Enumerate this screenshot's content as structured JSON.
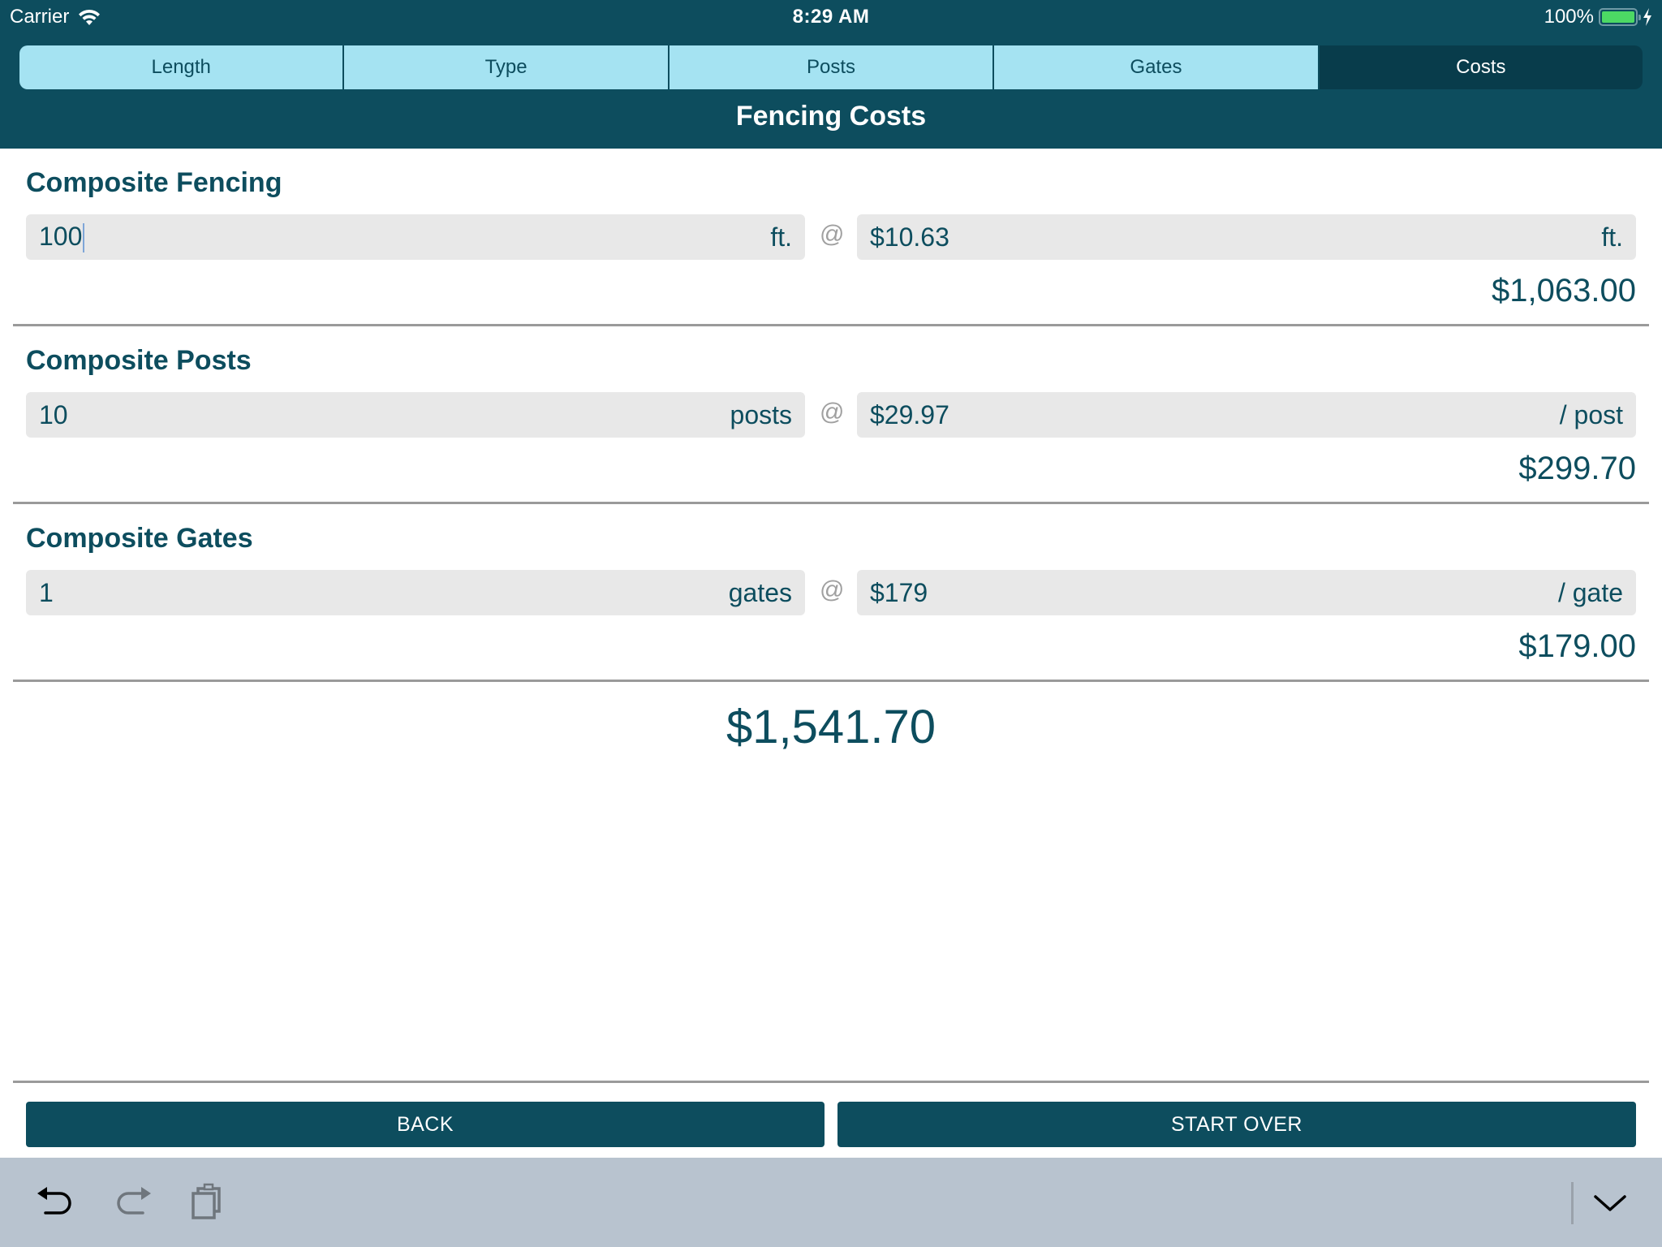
{
  "status_bar": {
    "carrier": "Carrier",
    "time": "8:29 AM",
    "battery_percent": "100%",
    "battery_level": 1.0,
    "charging": true
  },
  "tabs": [
    {
      "label": "Length",
      "active": false
    },
    {
      "label": "Type",
      "active": false
    },
    {
      "label": "Posts",
      "active": false
    },
    {
      "label": "Gates",
      "active": false
    },
    {
      "label": "Costs",
      "active": true
    }
  ],
  "header": {
    "title": "Fencing Costs"
  },
  "sections": [
    {
      "title": "Composite Fencing",
      "quantity": "100",
      "quantity_unit": "ft.",
      "at": "@",
      "price": "$10.63",
      "price_unit": "ft.",
      "subtotal": "$1,063.00"
    },
    {
      "title": "Composite Posts",
      "quantity": "10",
      "quantity_unit": "posts",
      "at": "@",
      "price": "$29.97",
      "price_unit": "/ post",
      "subtotal": "$299.70"
    },
    {
      "title": "Composite Gates",
      "quantity": "1",
      "quantity_unit": "gates",
      "at": "@",
      "price": "$179",
      "price_unit": "/ gate",
      "subtotal": "$179.00"
    }
  ],
  "total": "$1,541.70",
  "buttons": {
    "back": "BACK",
    "start_over": "START OVER"
  },
  "keyboard_bar": {
    "icons": [
      "undo-icon",
      "redo-icon",
      "paste-icon",
      "dismiss-keyboard-icon"
    ]
  },
  "colors": {
    "primary": "#0d4d5e",
    "segment_inactive": "#a5e3f2",
    "segment_active": "#083c4b",
    "field_bg": "#e8e8e8",
    "keyboard_bar": "#b8c3cf",
    "battery": "#4cd964"
  }
}
